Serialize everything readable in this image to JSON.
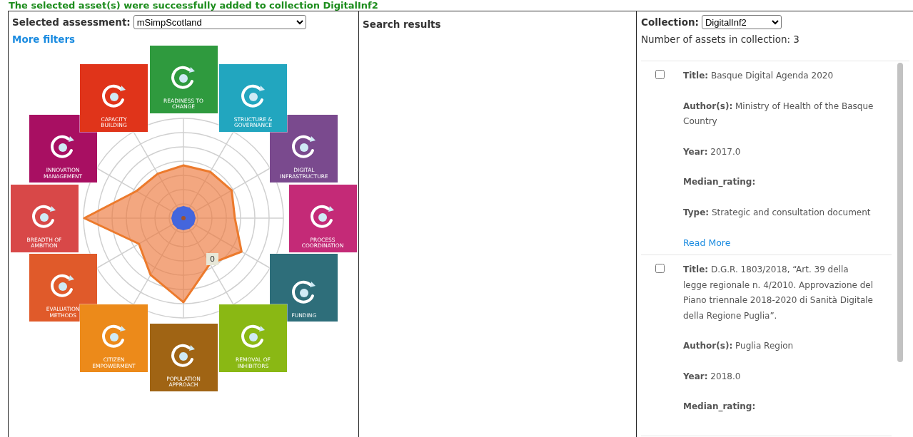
{
  "banner": {
    "text": "The selected asset(s) were successfully added to collection DigitalInf2"
  },
  "assessment_panel": {
    "label": "Selected assessment:",
    "selected_assessment": "mSimpScotland",
    "more_filters": "More filters",
    "radar": {
      "tooltip": "0",
      "tiles": [
        {
          "label": "READINESS TO CHANGE",
          "color": "#2f9a3e"
        },
        {
          "label": "STRUCTURE & GOVERNANCE",
          "color": "#22a6bf"
        },
        {
          "label": "DIGITAL INFRASTRUCTURE",
          "color": "#7a4a8e"
        },
        {
          "label": "PROCESS COORDINATION",
          "color": "#c42a77"
        },
        {
          "label": "FUNDING",
          "color": "#2e6e7a"
        },
        {
          "label": "REMOVAL OF INHIBITORS",
          "color": "#8ab814"
        },
        {
          "label": "POPULATION APPROACH",
          "color": "#a06414"
        },
        {
          "label": "CITIZEN EMPOWERMENT",
          "color": "#ec8a1a"
        },
        {
          "label": "EVALUATION METHODS",
          "color": "#e05a2a"
        },
        {
          "label": "BREADTH OF AMBITION",
          "color": "#d84848"
        },
        {
          "label": "INNOVATION MANAGEMENT",
          "color": "#a80f62"
        },
        {
          "label": "CAPACITY BUILDING",
          "color": "#e0341a"
        }
      ]
    }
  },
  "search_panel": {
    "heading": "Search results"
  },
  "collection_panel": {
    "label": "Collection:",
    "selected_collection": "DigitalInf2",
    "count_text": "Number of assets in collection: 3",
    "assets": [
      {
        "checked": false,
        "fields": [
          "**Title:** Basque Digital Agenda 2020",
          "**Author(s):** Ministry of Health of the Basque Country",
          "**Year:** 2017.0",
          "**Median_rating:**",
          "**Type:** Strategic and consultation document"
        ],
        "link": "Read More"
      },
      {
        "checked": false,
        "fields": [
          "**Title:** D.G.R. 1803/2018, “Art. 39 della legge regionale n. 4/2010. Approvazione del Piano triennale 2018-2020 di Sanità Digitale della Regione Puglia”.",
          "**Author(s):** Puglia Region",
          "**Year:** 2018.0",
          "**Median_rating:**"
        ]
      }
    ]
  }
}
